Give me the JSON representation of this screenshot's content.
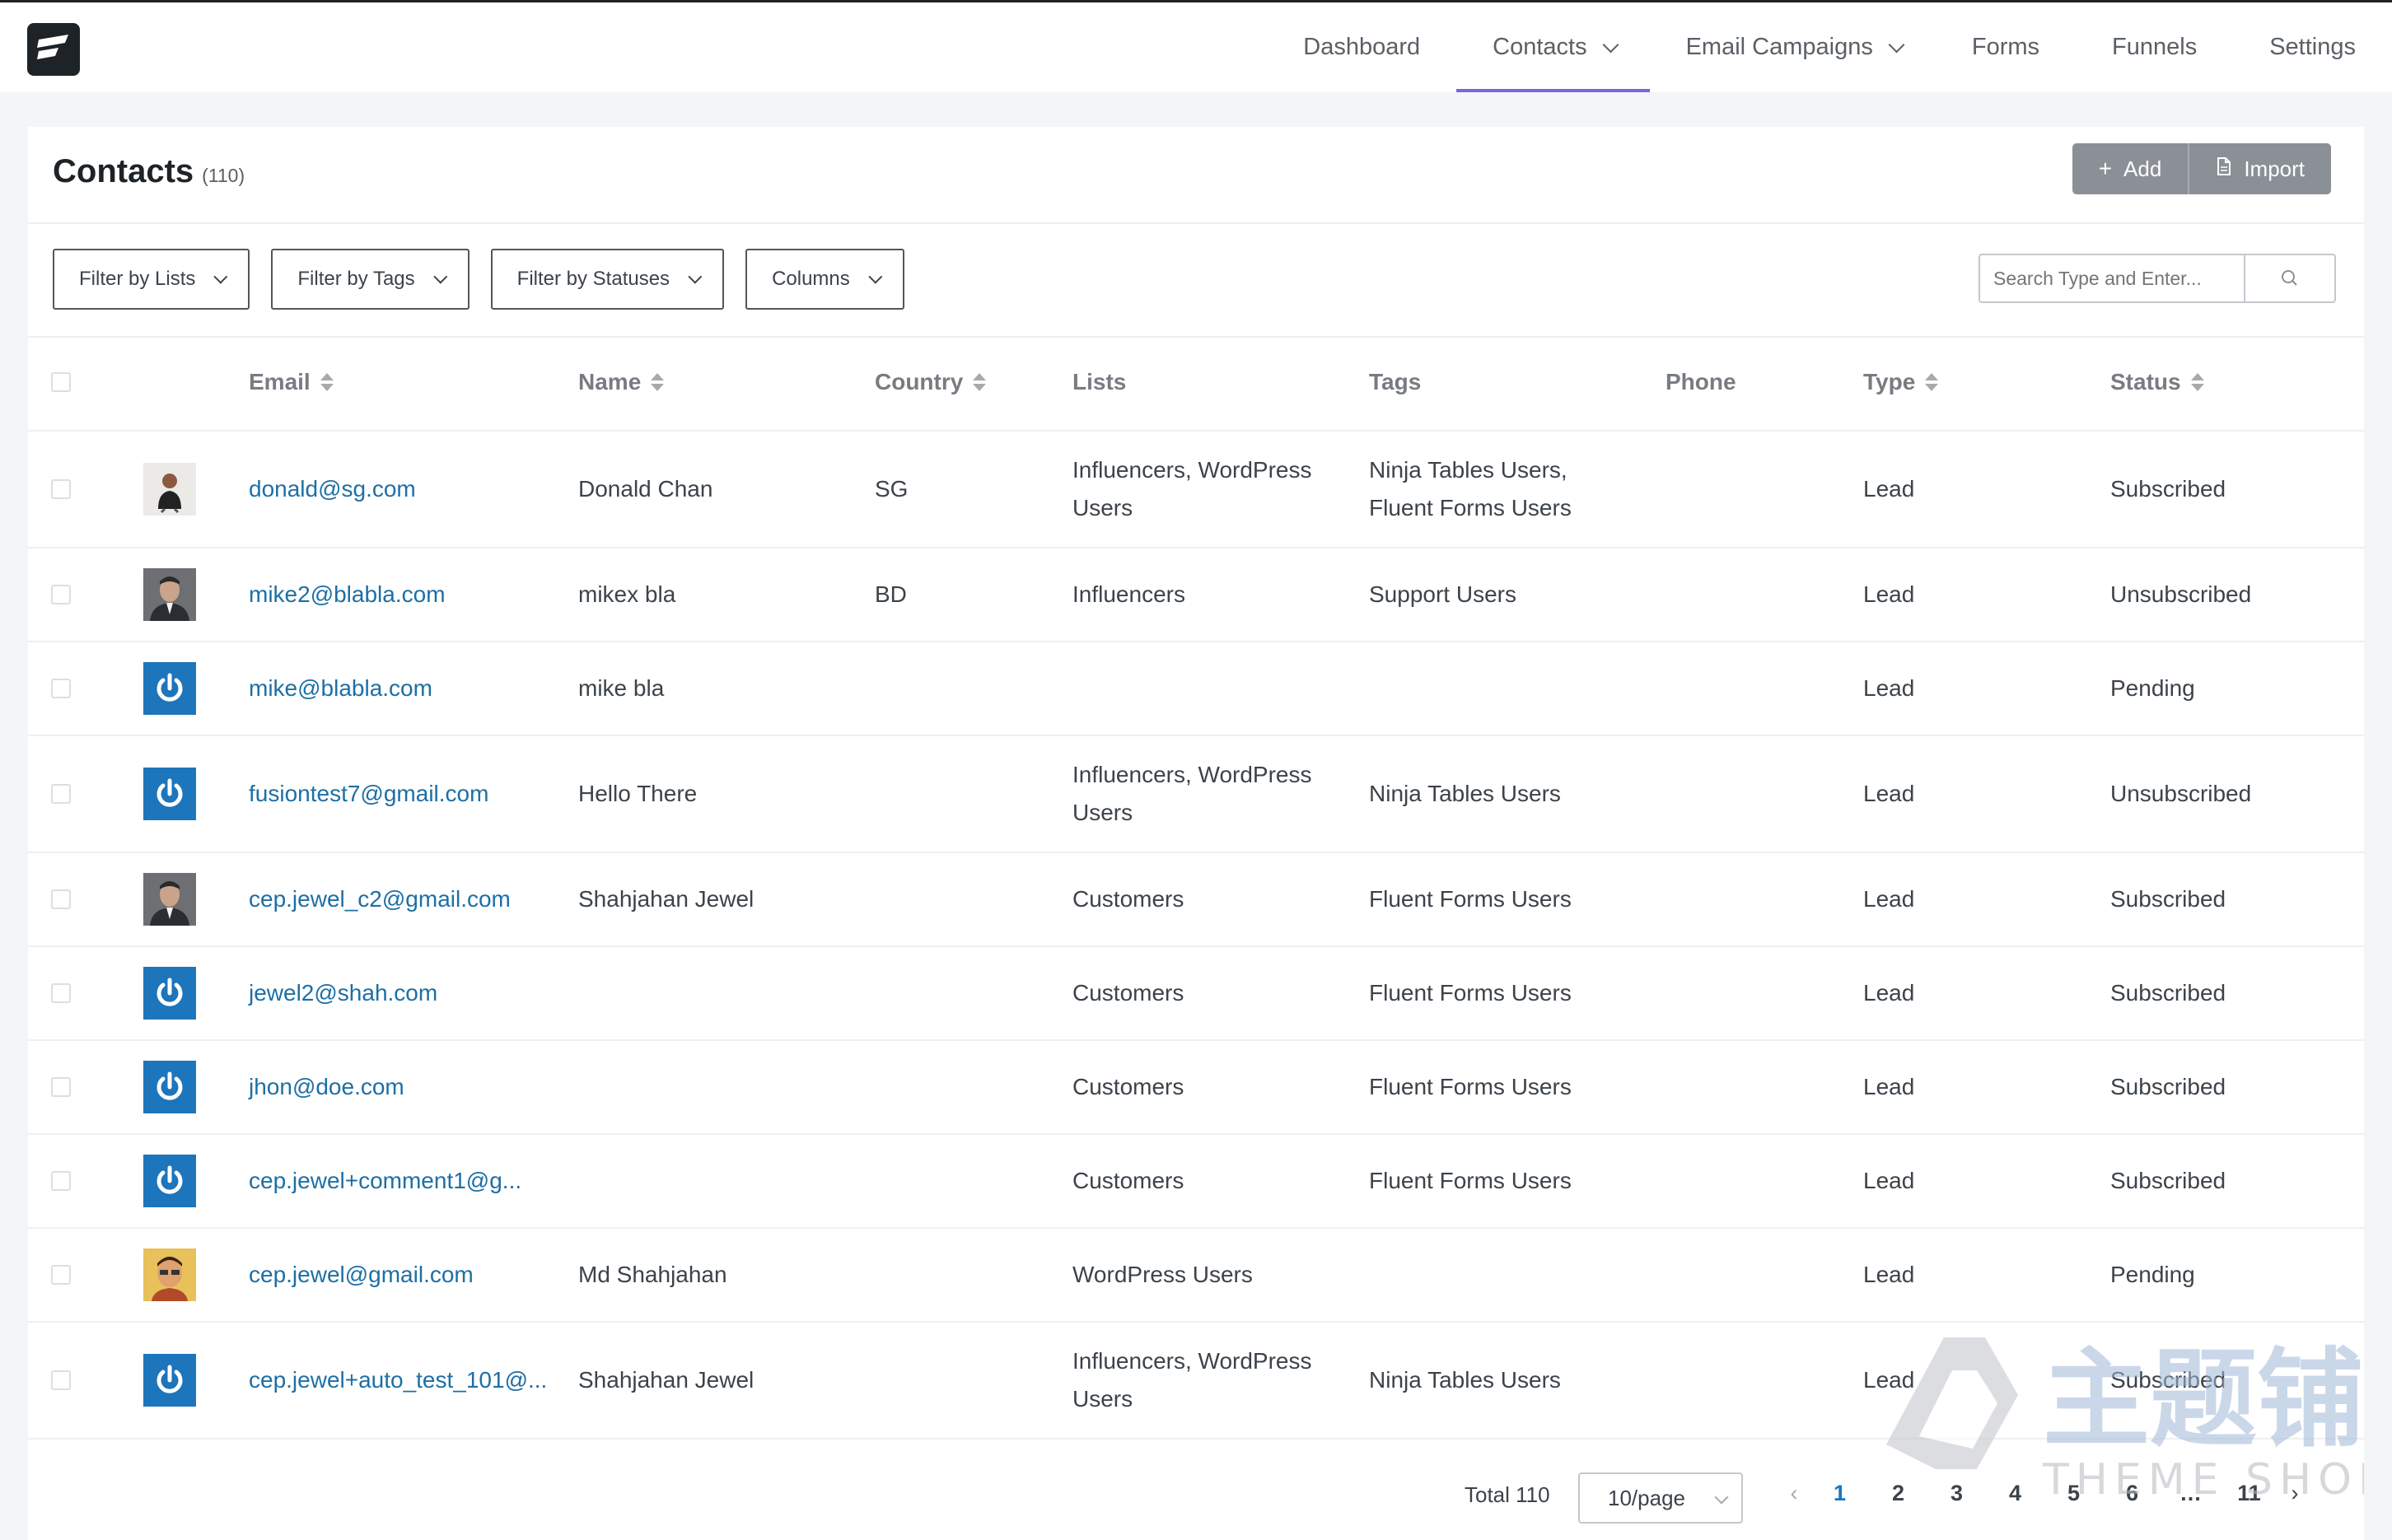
{
  "nav": {
    "items": [
      {
        "label": "Dashboard",
        "dropdown": false,
        "active": false
      },
      {
        "label": "Contacts",
        "dropdown": true,
        "active": true
      },
      {
        "label": "Email Campaigns",
        "dropdown": true,
        "active": false
      },
      {
        "label": "Forms",
        "dropdown": false,
        "active": false
      },
      {
        "label": "Funnels",
        "dropdown": false,
        "active": false
      },
      {
        "label": "Settings",
        "dropdown": false,
        "active": false
      }
    ]
  },
  "page": {
    "title": "Contacts",
    "count": "(110)"
  },
  "actions": {
    "add_label": "Add",
    "import_label": "Import"
  },
  "filters": [
    "Filter by Lists",
    "Filter by Tags",
    "Filter by Statuses",
    "Columns"
  ],
  "search": {
    "placeholder": "Search Type and Enter..."
  },
  "table": {
    "headers": {
      "email": "Email",
      "name": "Name",
      "country": "Country",
      "lists": "Lists",
      "tags": "Tags",
      "phone": "Phone",
      "type": "Type",
      "status": "Status"
    },
    "rows": [
      {
        "avatar": "photo-man-black-shirt",
        "email": "donald@sg.com",
        "name": "Donald Chan",
        "country": "SG",
        "lists": "Influencers, WordPress Users",
        "tags": "Ninja Tables Users, Fluent Forms Users",
        "phone": "",
        "type": "Lead",
        "status": "Subscribed"
      },
      {
        "avatar": "photo-man-suit",
        "email": "mike2@blabla.com",
        "name": "mikex bla",
        "country": "BD",
        "lists": "Influencers",
        "tags": "Support Users",
        "phone": "",
        "type": "Lead",
        "status": "Unsubscribed"
      },
      {
        "avatar": "power-icon",
        "email": "mike@blabla.com",
        "name": "mike bla",
        "country": "",
        "lists": "",
        "tags": "",
        "phone": "",
        "type": "Lead",
        "status": "Pending"
      },
      {
        "avatar": "power-icon",
        "email": "fusiontest7@gmail.com",
        "name": "Hello There",
        "country": "",
        "lists": "Influencers, WordPress Users",
        "tags": "Ninja Tables Users",
        "phone": "",
        "type": "Lead",
        "status": "Unsubscribed"
      },
      {
        "avatar": "photo-man-suit",
        "email": "cep.jewel_c2@gmail.com",
        "name": "Shahjahan Jewel",
        "country": "",
        "lists": "Customers",
        "tags": "Fluent Forms Users",
        "phone": "",
        "type": "Lead",
        "status": "Subscribed"
      },
      {
        "avatar": "power-icon",
        "email": "jewel2@shah.com",
        "name": "",
        "country": "",
        "lists": "Customers",
        "tags": "Fluent Forms Users",
        "phone": "",
        "type": "Lead",
        "status": "Subscribed"
      },
      {
        "avatar": "power-icon",
        "email": "jhon@doe.com",
        "name": "",
        "country": "",
        "lists": "Customers",
        "tags": "Fluent Forms Users",
        "phone": "",
        "type": "Lead",
        "status": "Subscribed"
      },
      {
        "avatar": "power-icon",
        "email": "cep.jewel+comment1@g...",
        "name": "",
        "country": "",
        "lists": "Customers",
        "tags": "Fluent Forms Users",
        "phone": "",
        "type": "Lead",
        "status": "Subscribed"
      },
      {
        "avatar": "photo-man-cartoon",
        "email": "cep.jewel@gmail.com",
        "name": "Md Shahjahan",
        "country": "",
        "lists": "WordPress Users",
        "tags": "",
        "phone": "",
        "type": "Lead",
        "status": "Pending"
      },
      {
        "avatar": "power-icon",
        "email": "cep.jewel+auto_test_101@...",
        "name": "Shahjahan Jewel",
        "country": "",
        "lists": "Influencers, WordPress Users",
        "tags": "Ninja Tables Users",
        "phone": "",
        "type": "Lead",
        "status": "Subscribed"
      }
    ]
  },
  "pagination": {
    "total_label": "Total 110",
    "page_size": "10/page",
    "pages": [
      "1",
      "2",
      "3",
      "4",
      "5",
      "6",
      "…",
      "11"
    ],
    "current": "1",
    "prev": "‹",
    "next": "›"
  },
  "watermark": {
    "text_cn": "主题铺",
    "text_en": "THEME SHOP"
  },
  "colors": {
    "accent": "#7f63d8",
    "link": "#1d6fa5",
    "avatar_blue": "#1d75bc"
  }
}
